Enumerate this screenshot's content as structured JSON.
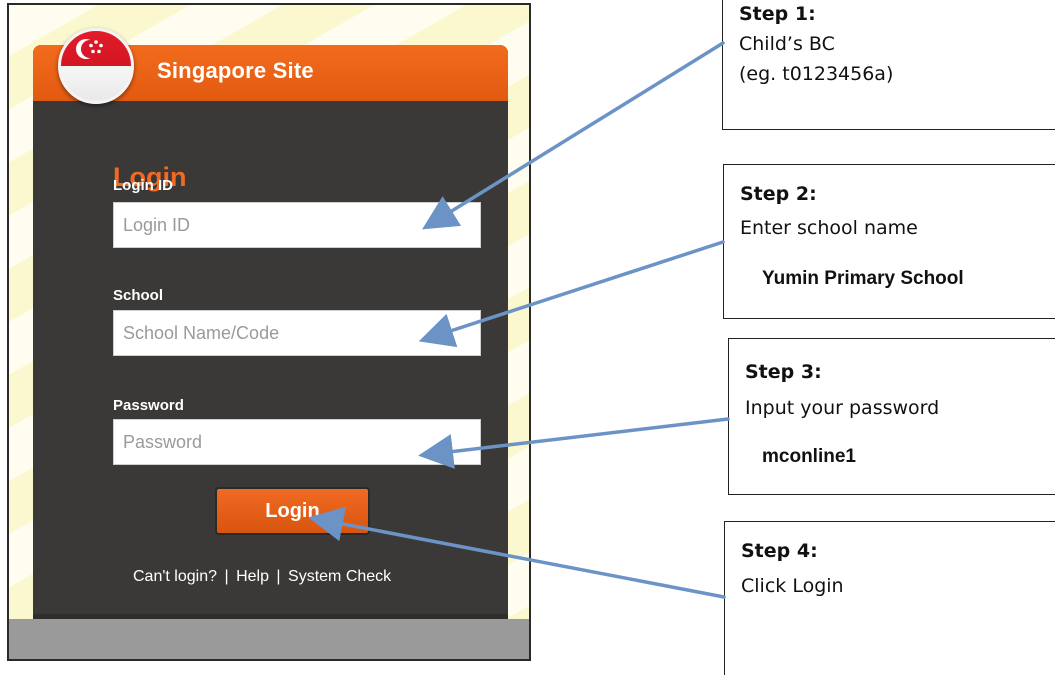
{
  "login_page": {
    "site_title": "Singapore Site",
    "heading": "Login",
    "login_id_label": "Login ID",
    "login_id_placeholder": "Login ID",
    "school_label": "School",
    "school_placeholder": "School Name/Code",
    "password_label": "Password",
    "password_placeholder": "Password",
    "login_button": "Login",
    "links": {
      "cant_login": "Can't login?",
      "separator": "|",
      "help": "Help",
      "system_check": "System Check"
    }
  },
  "steps": [
    {
      "title": "Step 1:",
      "line1": "Child’s BC",
      "line2": "(eg. t0123456a)",
      "value": ""
    },
    {
      "title": "Step 2:",
      "line1": "Enter school name",
      "line2": "",
      "value": "Yumin Primary School"
    },
    {
      "title": "Step 3:",
      "line1": "Input your password",
      "line2": "",
      "value": "mconline1"
    },
    {
      "title": "Step 4:",
      "line1": "Click Login",
      "line2": "",
      "value": ""
    }
  ],
  "colors": {
    "accent_orange": "#f26a21",
    "card_background": "#3b3938",
    "arrow_blue": "#6b93c6",
    "page_background": "#fbf7cf"
  },
  "icons": {
    "flag": "singapore-flag-icon"
  }
}
